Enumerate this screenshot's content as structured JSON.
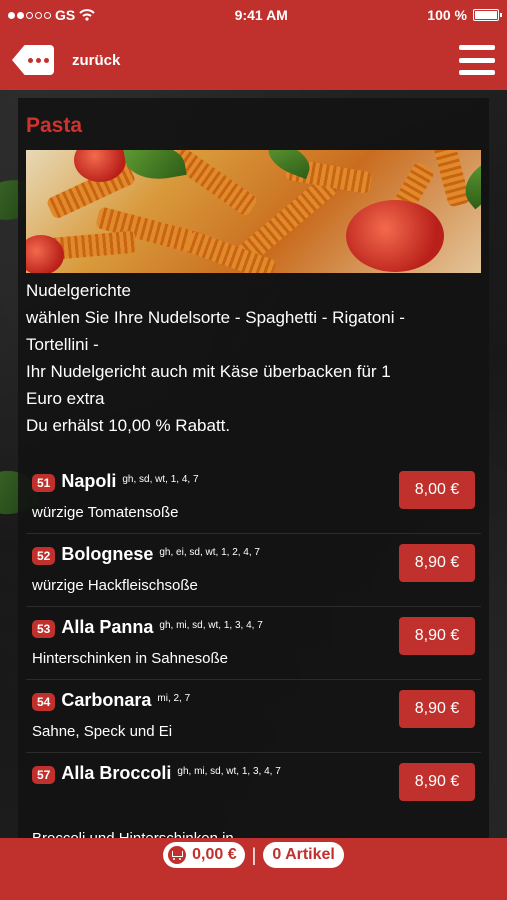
{
  "status": {
    "carrier": "GS",
    "time": "9:41 AM",
    "battery": "100 %"
  },
  "nav": {
    "back_label": "zurück"
  },
  "category": {
    "title": "Pasta",
    "description": [
      "Nudelgerichte",
      "wählen Sie Ihre Nudelsorte - Spaghetti - Rigatoni -",
      "Tortellini -",
      "Ihr Nudelgericht auch mit Käse überbacken für 1",
      "Euro extra",
      "Du erhälst 10,00 % Rabatt."
    ]
  },
  "items": [
    {
      "num": "51",
      "name": "Napoli",
      "allergens": "gh, sd, wt, 1, 4, 7",
      "subtitle": "würzige Tomatensoße",
      "price": "8,00 €"
    },
    {
      "num": "52",
      "name": "Bolognese",
      "allergens": "gh, ei, sd, wt, 1, 2, 4, 7",
      "subtitle": "würzige Hackfleischsoße",
      "price": "8,90 €"
    },
    {
      "num": "53",
      "name": "Alla Panna",
      "allergens": "gh, mi, sd, wt, 1, 3, 4, 7",
      "subtitle": "Hinterschinken in Sahnesoße",
      "price": "8,90 €"
    },
    {
      "num": "54",
      "name": "Carbonara",
      "allergens": "mi, 2, 7",
      "subtitle": "Sahne, Speck und Ei",
      "price": "8,90 €"
    },
    {
      "num": "57",
      "name": "Alla Broccoli",
      "allergens": "gh, mi, sd, wt, 1, 3, 4, 7",
      "subtitle": "Broccoli und Hinterschinken in",
      "price": "8,90 €"
    }
  ],
  "cart": {
    "total": "0,00 €",
    "separator": "|",
    "count": "0 Artikel"
  },
  "colors": {
    "brand_red": "#c0302c",
    "title_red": "#d2322d"
  }
}
